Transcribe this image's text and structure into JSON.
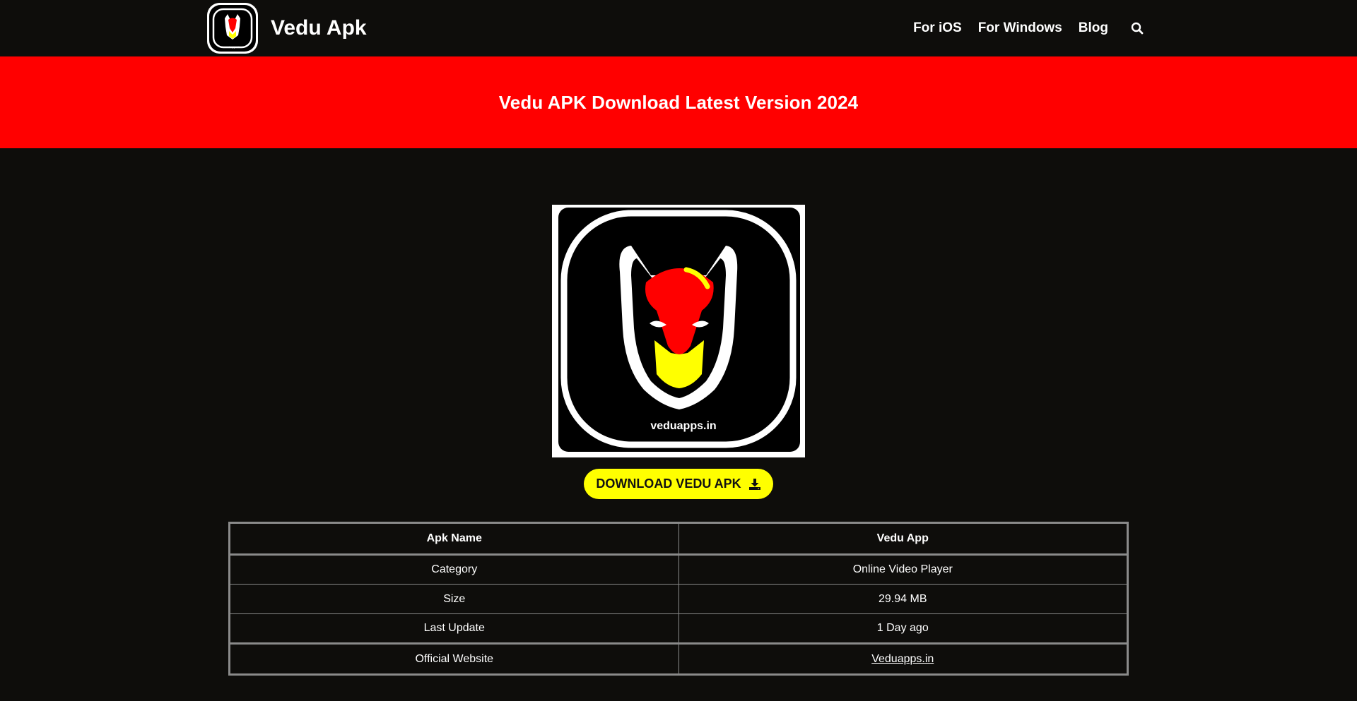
{
  "header": {
    "brand_name": "Vedu Apk",
    "nav": [
      "For iOS",
      "For Windows",
      "Blog"
    ],
    "search_icon": "search-icon"
  },
  "banner": {
    "title": "Vedu APK Download Latest Version 2024"
  },
  "hero": {
    "logo_caption": "veduapps.in"
  },
  "download": {
    "label": "DOWNLOAD VEDU APK",
    "icon": "download-icon"
  },
  "table": {
    "header": [
      "Apk Name",
      "Vedu App"
    ],
    "rows": [
      [
        "Category",
        "Online Video Player"
      ],
      [
        "Size",
        "29.94 MB"
      ],
      [
        "Last Update",
        "1 Day ago"
      ]
    ],
    "last_row": [
      "Official Website",
      "Veduapps.in"
    ]
  },
  "colors": {
    "background": "#0e0d0b",
    "banner": "#ff0000",
    "button": "#ffff00",
    "border": "#8a8a8a"
  }
}
